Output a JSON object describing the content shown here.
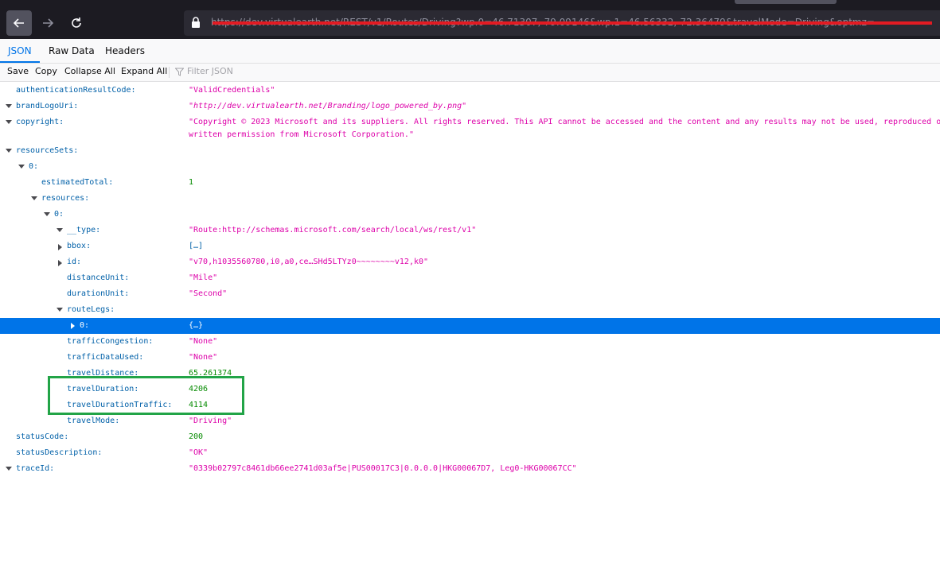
{
  "browser": {
    "url": "https://dev.virtualearth.net/REST/v1/Routes/Driving?wp.0=46.71307,-79.09146&wp.1=46.56332,-72.36479&travelMode=Driving&optmz=",
    "back_icon": "arrow-left-icon",
    "forward_icon": "arrow-right-icon",
    "reload_icon": "reload-icon",
    "lock_icon": "lock-icon"
  },
  "viewer_tabs": [
    {
      "label": "JSON",
      "active": true
    },
    {
      "label": "Raw Data",
      "active": false
    },
    {
      "label": "Headers",
      "active": false
    }
  ],
  "toolbar": {
    "save": "Save",
    "copy": "Copy",
    "collapse_all": "Collapse All",
    "expand_all": "Expand All",
    "filter_placeholder": "Filter JSON"
  },
  "rows": {
    "authenticationResultCode": {
      "key": "authenticationResultCode:",
      "value": "\"ValidCredentials\""
    },
    "brandLogoUri": {
      "key": "brandLogoUri:",
      "value": "\"http://dev.virtualearth.net/Branding/logo_powered_by.png\""
    },
    "copyright": {
      "key": "copyright:",
      "value_line1": "\"Copyright © 2023 Microsoft and its suppliers. All rights reserved. This API cannot be accessed and the content and any results may not be used, reproduced or",
      "value_line2": "written permission from Microsoft Corporation.\""
    },
    "resourceSets": {
      "key": "resourceSets:"
    },
    "rs0": {
      "key": "0:"
    },
    "estimatedTotal": {
      "key": "estimatedTotal:",
      "value": "1"
    },
    "resources": {
      "key": "resources:"
    },
    "res0": {
      "key": "0:"
    },
    "type": {
      "key": "__type:",
      "value": "\"Route:http://schemas.microsoft.com/search/local/ws/rest/v1\""
    },
    "bbox": {
      "key": "bbox:",
      "value": "[…]"
    },
    "id": {
      "key": "id:",
      "value": "\"v70,h1035560780,i0,a0,ce…SHd5LTYz0~~~~~~~~v12,k0\""
    },
    "distanceUnit": {
      "key": "distanceUnit:",
      "value": "\"Mile\""
    },
    "durationUnit": {
      "key": "durationUnit:",
      "value": "\"Second\""
    },
    "routeLegs": {
      "key": "routeLegs:"
    },
    "leg0": {
      "key": "0:",
      "value": "{…}"
    },
    "trafficCongestion": {
      "key": "trafficCongestion:",
      "value": "\"None\""
    },
    "trafficDataUsed": {
      "key": "trafficDataUsed:",
      "value": "\"None\""
    },
    "travelDistance": {
      "key": "travelDistance:",
      "value": "65.261374"
    },
    "travelDuration": {
      "key": "travelDuration:",
      "value": "4206"
    },
    "travelDurationTraffic": {
      "key": "travelDurationTraffic:",
      "value": "4114"
    },
    "travelMode": {
      "key": "travelMode:",
      "value": "\"Driving\""
    },
    "statusCode": {
      "key": "statusCode:",
      "value": "200"
    },
    "statusDescription": {
      "key": "statusDescription:",
      "value": "\"OK\""
    },
    "traceId": {
      "key": "traceId:",
      "value": "\"0339b02797c8461db66ee2741d03af5e|PUS00017C3|0.0.0.0|HKG00067D7, Leg0-HKG00067CC\""
    }
  },
  "colors": {
    "key": "#0060a8",
    "string": "#dd00a9",
    "number": "#058b00",
    "selection": "#0074e8",
    "highlight_box": "#22a447"
  }
}
